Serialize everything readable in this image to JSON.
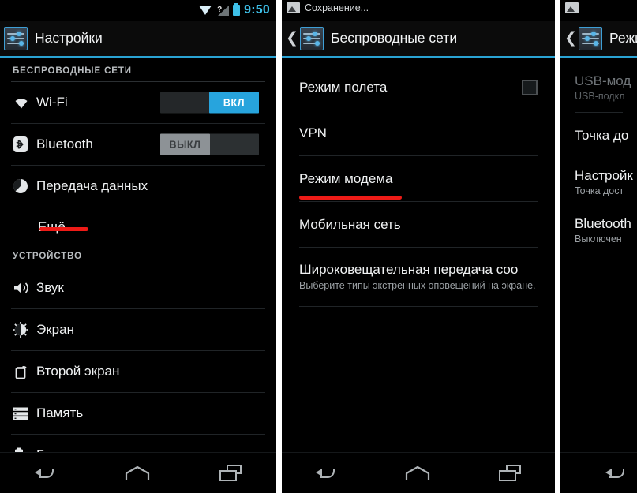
{
  "statusbar": {
    "time": "9:50",
    "signal_badge": "?",
    "icons": [
      "wifi-icon",
      "signal-icon",
      "battery-icon"
    ]
  },
  "panel1": {
    "title": "Настройки",
    "app_icon": "settings-icon",
    "sections": [
      {
        "header": "БЕСПРОВОДНЫЕ СЕТИ",
        "items": [
          {
            "label": "Wi-Fi",
            "icon": "wifi-icon",
            "control": "toggle",
            "toggle_state": "on",
            "toggle_label": "ВКЛ"
          },
          {
            "label": "Bluetooth",
            "icon": "bluetooth-icon",
            "control": "toggle",
            "toggle_state": "off",
            "toggle_label": "ВЫКЛ"
          },
          {
            "label": "Передача данных",
            "icon": "data-usage-icon",
            "control": "none"
          },
          {
            "label": "Ещё...",
            "icon": "none",
            "control": "none",
            "annotated": true
          }
        ]
      },
      {
        "header": "УСТРОЙСТВО",
        "items": [
          {
            "label": "Звук",
            "icon": "sound-icon",
            "control": "none"
          },
          {
            "label": "Экран",
            "icon": "display-icon",
            "control": "none"
          },
          {
            "label": "Второй экран",
            "icon": "second-screen-icon",
            "control": "none"
          },
          {
            "label": "Память",
            "icon": "storage-icon",
            "control": "none"
          },
          {
            "label": "Батарея",
            "icon": "battery-icon",
            "control": "none"
          }
        ]
      }
    ]
  },
  "panel2": {
    "notification": "Сохранение...",
    "notification_icon": "photo-icon",
    "title": "Беспроводные сети",
    "app_icon": "settings-icon",
    "back_icon": "chevron-left-icon",
    "items": [
      {
        "label": "Режим полета",
        "control": "checkbox",
        "checked": false
      },
      {
        "label": "VPN",
        "control": "none"
      },
      {
        "label": "Режим модема",
        "control": "none",
        "annotated": true
      },
      {
        "label": "Мобильная сеть",
        "control": "none"
      },
      {
        "label": "Широковещательная передача соо",
        "sub": "Выберите типы экстренных оповещений на экране.",
        "control": "none"
      }
    ]
  },
  "panel3": {
    "notification_icon": "photo-icon",
    "title": "Режим",
    "app_icon": "settings-icon",
    "back_icon": "chevron-left-icon",
    "items": [
      {
        "label": "USB-мод",
        "sub": "USB-подкл",
        "disabled": true
      },
      {
        "label": "Точка до",
        "sub": "",
        "disabled": false
      },
      {
        "label": "Настройк",
        "sub": "Точка дост",
        "disabled": false
      },
      {
        "label": "Bluetooth",
        "sub": "Выключен",
        "disabled": false
      }
    ]
  },
  "navbar": {
    "back": "back-icon",
    "home": "home-icon",
    "recents": "recents-icon"
  },
  "colors": {
    "accent": "#2aa3d4",
    "toggle_on": "#27a4dd",
    "toggle_off": "#8d9296",
    "annotation": "#ee1b17",
    "background": "#000000",
    "time": "#3ec0e8"
  }
}
